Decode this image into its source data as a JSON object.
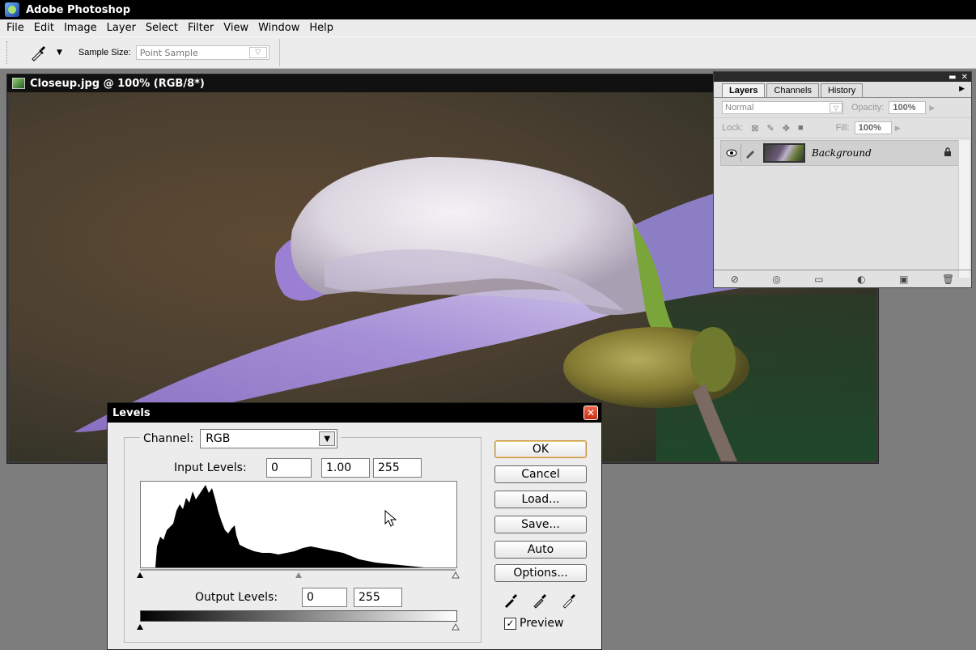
{
  "app": {
    "title": "Adobe Photoshop"
  },
  "menu": [
    "File",
    "Edit",
    "Image",
    "Layer",
    "Select",
    "Filter",
    "View",
    "Window",
    "Help"
  ],
  "options_bar": {
    "sample_size_label": "Sample Size:",
    "sample_size_value": "Point Sample",
    "tool_icon": "eyedropper-icon"
  },
  "document": {
    "title": "Closeup.jpg @ 100% (RGB/8*)"
  },
  "layers_panel": {
    "tabs": [
      "Layers",
      "Channels",
      "History"
    ],
    "active_tab": "Layers",
    "blend_mode": "Normal",
    "opacity_label": "Opacity:",
    "opacity_value": "100%",
    "lock_label": "Lock:",
    "fill_label": "Fill:",
    "fill_value": "100%",
    "layer_name": "Background"
  },
  "levels_dialog": {
    "title": "Levels",
    "channel_label": "Channel:",
    "channel_value": "RGB",
    "input_levels_label": "Input Levels:",
    "input_black": "0",
    "input_gamma": "1.00",
    "input_white": "255",
    "output_levels_label": "Output Levels:",
    "output_black": "0",
    "output_white": "255",
    "buttons": {
      "ok": "OK",
      "cancel": "Cancel",
      "load": "Load...",
      "save": "Save...",
      "auto": "Auto",
      "options": "Options..."
    },
    "preview_label": "Preview",
    "preview_checked": true
  },
  "colors": {
    "title_bar": "#000000",
    "chrome": "#ececec",
    "workspace": "#7d7d7d",
    "petal": "#9a86c9"
  }
}
